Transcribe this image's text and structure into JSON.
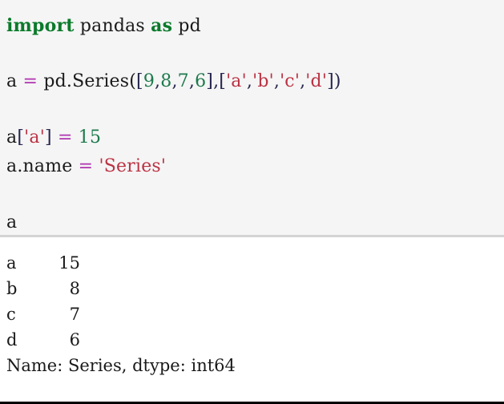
{
  "cell": {
    "type": "jupyter-code-cell",
    "input_background": "#f5f5f5",
    "output_background": "#ffffff",
    "divider_color": "#d4d4d4",
    "bottom_border_color": "#000000"
  },
  "syntax_colors": {
    "keyword": "#0b7a2b",
    "operator": "#b033b0",
    "number": "#1d7a4d",
    "string": "#bb3344",
    "plain": "#1a1a1a",
    "punctuation": "#262650"
  },
  "code": {
    "line1": {
      "kw_import": "import",
      "module": " pandas ",
      "kw_as": "as",
      "alias": " pd"
    },
    "line3": {
      "var": "a ",
      "eq": "=",
      "call": " pd.Series(",
      "lb1": "[",
      "n1": "9",
      "c1": ",",
      "n2": "8",
      "c2": ",",
      "n3": "7",
      "c3": ",",
      "n4": "6",
      "rb1": "]",
      "comma": ",",
      "lb2": "[",
      "s1": "'a'",
      "c4": ",",
      "s2": "'b'",
      "c5": ",",
      "s3": "'c'",
      "c6": ",",
      "s4": "'d'",
      "rb2": "]",
      "close": ")"
    },
    "line5": {
      "var": "a",
      "lb": "[",
      "key": "'a'",
      "rb": "]",
      "eq": "=",
      "val": "15"
    },
    "line6": {
      "attr": "a.name ",
      "eq": "=",
      "val": "'Series'"
    },
    "line8": {
      "expr": "a"
    }
  },
  "output": {
    "rows": [
      {
        "index": "a",
        "value": "15"
      },
      {
        "index": "b",
        "value": "8"
      },
      {
        "index": "c",
        "value": "7"
      },
      {
        "index": "d",
        "value": "6"
      }
    ],
    "summary": "Name: Series, dtype: int64"
  }
}
